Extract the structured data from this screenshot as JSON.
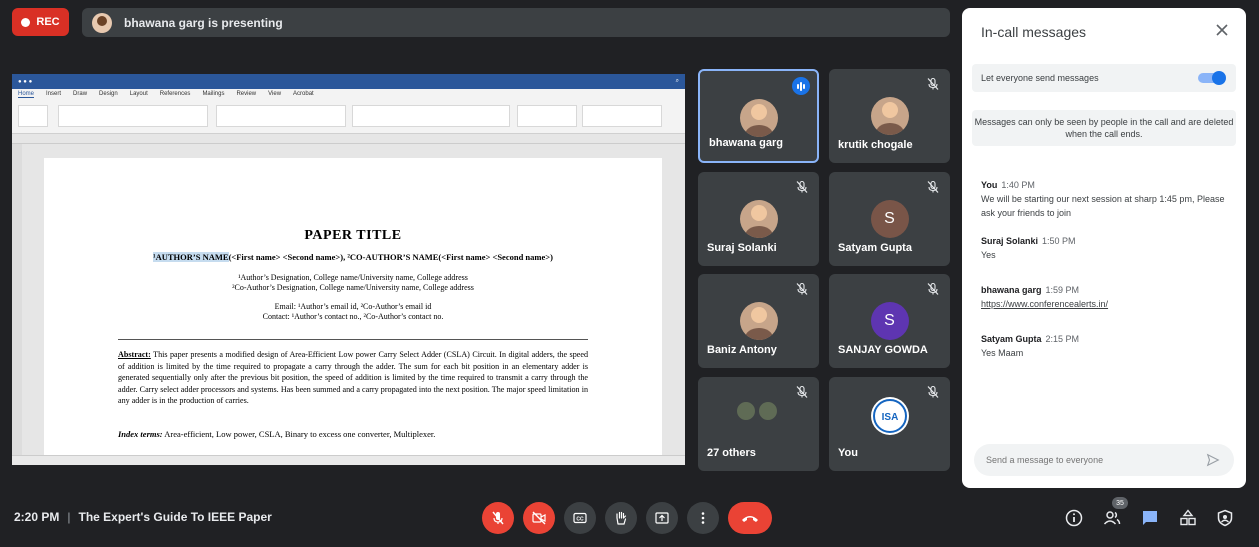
{
  "recording": {
    "label": "REC"
  },
  "presenting_banner": {
    "text": "bhawana garg is presenting"
  },
  "document": {
    "ribbon_tabs": [
      "Home",
      "Insert",
      "Draw",
      "Design",
      "Layout",
      "References",
      "Mailings",
      "Review",
      "View",
      "Acrobat"
    ],
    "paper_title": "PAPER TITLE",
    "authors_highlight": "¹AUTHOR’S NAME",
    "authors_rest": "(<First name> <Second name>), ²CO-AUTHOR’S NAME(<First name> <Second name>)",
    "affiliation_1": "¹Author’s Designation, College name/University name, College address",
    "affiliation_2": "²Co-Author’s Designation, College name/University name, College address",
    "email_line": "Email: ¹Author’s email id, ²Co-Author’s email id",
    "contact_line": "Contact: ¹Author’s contact no., ²Co-Author’s contact no.",
    "abstract_label": "Abstract:",
    "abstract_text": " This paper presents a modified design of Area-Efficient Low power Carry Select Adder (CSLA) Circuit. In digital adders, the speed of addition is limited by the time required to propagate a carry through the adder. The sum for each bit position in an elementary adder is generated sequentially only after the previous bit position, the speed of addition is limited by the time required to transmit a carry through the adder. Carry select adder processors and systems.  Has been summed and a carry propagated into the next position. The major speed limitation in any adder is in the production of carries.",
    "index_label": "Index terms:",
    "index_text": " Area-efficient, Low power, CSLA, Binary to excess one converter, Multiplexer."
  },
  "participants": [
    {
      "name": "bhawana garg",
      "initial": "",
      "color": "#c7a58a",
      "speaking": true
    },
    {
      "name": "krutik chogale",
      "initial": "",
      "color": "#c7a58a",
      "speaking": false
    },
    {
      "name": "Suraj Solanki",
      "initial": "",
      "color": "#c7a58a",
      "speaking": false
    },
    {
      "name": "Satyam Gupta",
      "initial": "S",
      "color": "#795548",
      "speaking": false
    },
    {
      "name": "Baniz Antony",
      "initial": "",
      "color": "#c7a58a",
      "speaking": false
    },
    {
      "name": "SANJAY GOWDA",
      "initial": "S",
      "color": "#5e35b1",
      "speaking": false
    },
    {
      "name": "27 others",
      "initial": "",
      "color": "#5f6b55",
      "speaking": false
    },
    {
      "name": "You",
      "initial": "ISA",
      "color": "#ffffff",
      "speaking": false
    }
  ],
  "chat": {
    "title": "In-call messages",
    "toggle_label": "Let everyone send messages",
    "toggle_on": true,
    "note": "Messages can only be seen by people in the call and are deleted when the call ends.",
    "messages": [
      {
        "sender": "You",
        "time": "1:40 PM",
        "text": "We will be starting our next session at sharp 1:45 pm, Please ask your friends to join"
      },
      {
        "sender": "Suraj Solanki",
        "time": "1:50 PM",
        "text": "Yes"
      },
      {
        "sender": "bhawana garg",
        "time": "1:59 PM",
        "text": "https://www.conferencealerts.in/"
      },
      {
        "sender": "Satyam Gupta",
        "time": "2:15 PM",
        "text": "Yes Maam"
      }
    ],
    "input_placeholder": "Send a message to everyone"
  },
  "meeting": {
    "time": "2:20 PM",
    "separator": "|",
    "title": "The Expert's Guide To IEEE Paper"
  },
  "people_count": "35",
  "colors": {
    "background": "#202124",
    "tile": "#3c4043",
    "danger": "#ea4335",
    "accent": "#1a73e8"
  }
}
